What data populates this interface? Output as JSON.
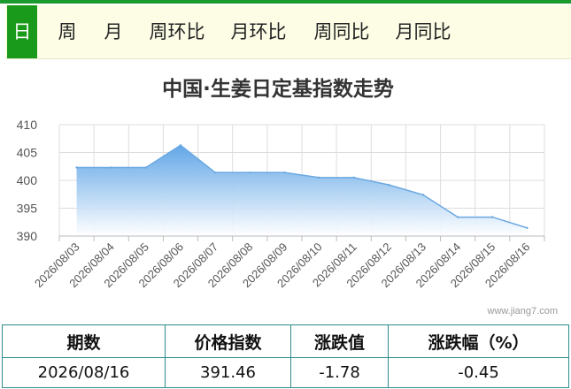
{
  "tabs": [
    {
      "label": "日",
      "active": true
    },
    {
      "label": "周",
      "active": false
    },
    {
      "label": "月",
      "active": false
    },
    {
      "label": "周环比",
      "active": false
    },
    {
      "label": "月环比",
      "active": false
    },
    {
      "label": "周同比",
      "active": false
    },
    {
      "label": "月同比",
      "active": false
    }
  ],
  "watermark": "www.jiang7.com",
  "summary": {
    "headers": [
      "期数",
      "价格指数",
      "涨跌值",
      "涨跌幅（%）"
    ],
    "row": [
      "2026/08/16",
      "391.46",
      "-1.78",
      "-0.45"
    ]
  },
  "colors": {
    "accent": "#1a9a1a",
    "line": "#6aa8e0",
    "fill_top": "#5aa2e6",
    "table_border": "#2e8b8b"
  },
  "chart_data": {
    "type": "area",
    "title": "中国·生姜日定基指数走势",
    "xlabel": "",
    "ylabel": "",
    "x": [
      "2026/08/03",
      "2026/08/04",
      "2026/08/05",
      "2026/08/06",
      "2026/08/07",
      "2026/08/08",
      "2026/08/09",
      "2026/08/10",
      "2026/08/11",
      "2026/08/12",
      "2026/08/13",
      "2026/08/14",
      "2026/08/15",
      "2026/08/16"
    ],
    "values": [
      402.3,
      402.3,
      402.3,
      406.3,
      401.4,
      401.4,
      401.4,
      400.5,
      400.5,
      399.2,
      397.4,
      393.4,
      393.4,
      391.46
    ],
    "ylim": [
      390,
      410
    ],
    "yticks": [
      "390",
      "395",
      "400",
      "405",
      "410"
    ],
    "grid": true,
    "legend": "none"
  }
}
